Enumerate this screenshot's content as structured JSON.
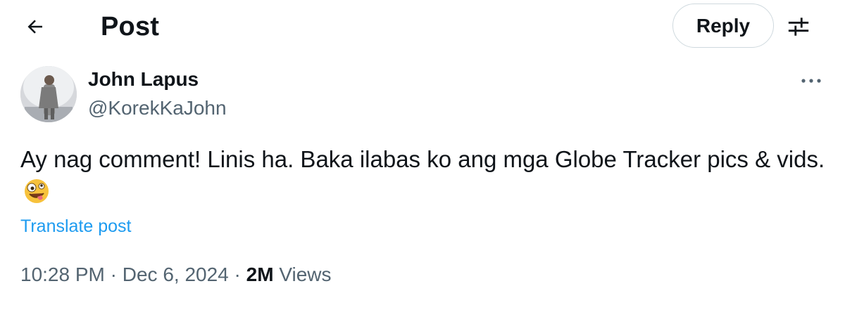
{
  "header": {
    "title": "Post",
    "back_icon": "arrow-left-icon",
    "reply_label": "Reply",
    "filter_icon": "sliders-icon"
  },
  "post": {
    "author": {
      "name": "John Lapus",
      "handle": "@KorekKaJohn"
    },
    "more_icon": "more-horizontal-icon",
    "text": "Ay nag comment! Linis ha. Baka ilabas ko ang mga Globe Tracker pics & vids.",
    "emoji_icon": "zany-face-emoji",
    "translate_label": "Translate post",
    "time": "10:28 PM",
    "separator": "·",
    "date": "Dec 6, 2024",
    "views_count": "2M",
    "views_label": "Views"
  },
  "colors": {
    "text": "#0f1419",
    "secondary": "#536471",
    "link": "#1d9bf0",
    "border": "#cfd9de"
  }
}
